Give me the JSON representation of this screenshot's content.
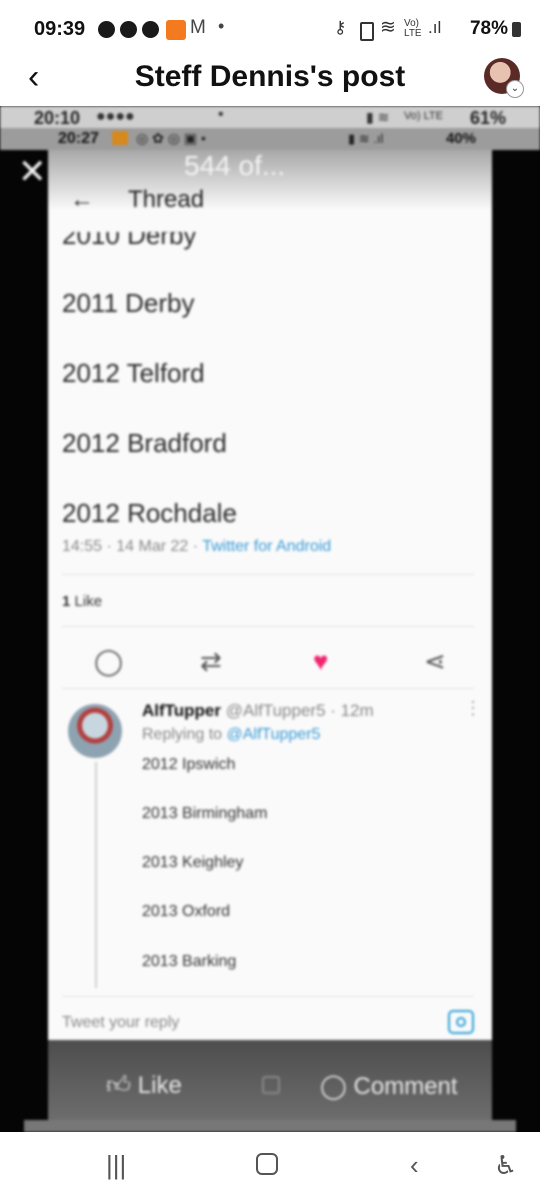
{
  "status_bar": {
    "time": "09:39",
    "battery": "78%",
    "signal_icons": [
      "messenger-icon",
      "messenger-icon",
      "messenger-icon",
      "temu-icon",
      "gmail-icon",
      "dot-icon",
      "key-icon",
      "battery-saver-icon",
      "wifi-icon",
      "volte-icon",
      "signal-icon",
      "battery-icon"
    ]
  },
  "header": {
    "back_icon": "chevron-left-icon",
    "title": "Steff Dennis's post"
  },
  "post_image": {
    "inner_status_1": {
      "time": "20:10",
      "battery": "61%",
      "net": "Vo) LTE"
    },
    "inner_status_2": {
      "time": "20:27",
      "battery": "40%"
    },
    "close_label": "✕",
    "counter": "544 of...",
    "thread_header": {
      "back": "←",
      "title": "Thread"
    },
    "cities": [
      "2010 Derby",
      "2011 Derby",
      "2012 Telford",
      "2012 Bradford",
      "2012 Rochdale"
    ],
    "tweet_meta": {
      "time": "14:55 · 14 Mar 22 · ",
      "source": "Twitter for Android"
    },
    "likes": {
      "count": "1",
      "label": "Like"
    },
    "reply": {
      "name": "AlfTupper",
      "handle": " @AlfTupper5 · 12m",
      "replying_prefix": "Replying to ",
      "replying_user": "@AlfTupper5",
      "cities": [
        "2012 Ipswich",
        "2013 Birmingham",
        "2013 Keighley",
        "2013 Oxford",
        "2013 Barking"
      ]
    },
    "reply_placeholder": "Tweet your reply",
    "fb_like": "Like",
    "fb_comment": "Comment"
  },
  "colors": {
    "heart": "#f0256f",
    "link": "#3a9bd6"
  }
}
